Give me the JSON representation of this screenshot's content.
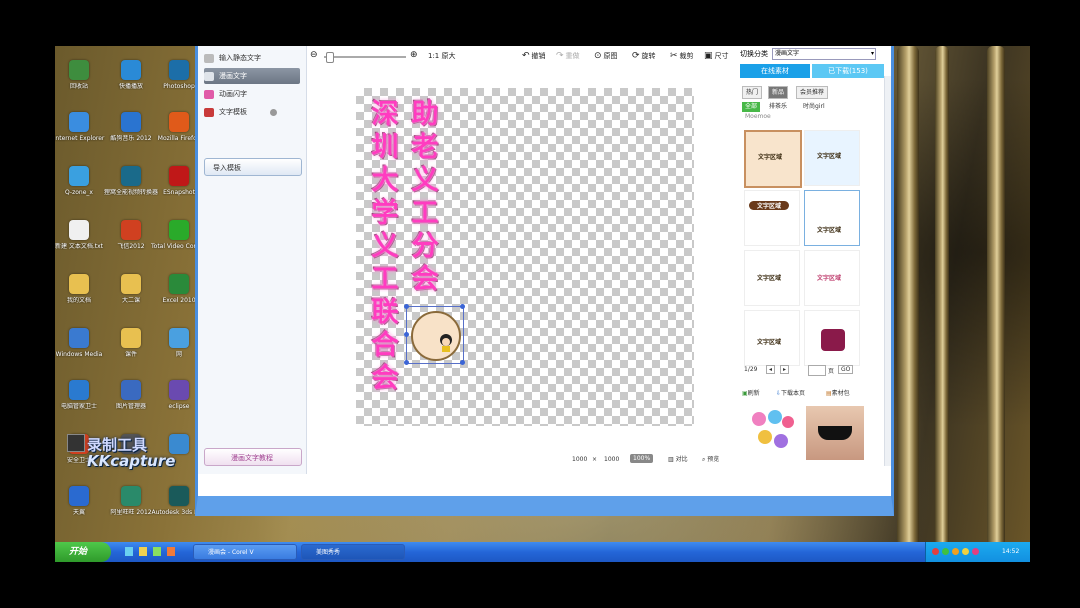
{
  "colors": {
    "accent": "#ff3cc0",
    "taskbar": "#2466d8",
    "start": "#3f9a2b",
    "tab_active": "#1aa0e8"
  },
  "desktop": {
    "icons": [
      {
        "label": "回收站",
        "icon": "recycle-bin-icon",
        "color": "#3e8d3e"
      },
      {
        "label": "快播播放",
        "icon": "kuaibo-icon",
        "color": "#2a8ad6"
      },
      {
        "label": "Photoshop",
        "icon": "photoshop-icon",
        "color": "#1c6ea8"
      },
      {
        "label": "Internet Explorer",
        "icon": "ie-icon",
        "color": "#3a8de0"
      },
      {
        "label": "酷狗音乐 2012",
        "icon": "kugou-icon",
        "color": "#2a74d0"
      },
      {
        "label": "Mozilla Firefox",
        "icon": "firefox-icon",
        "color": "#e05a1a"
      },
      {
        "label": "Q-zone_x",
        "icon": "globe-icon",
        "color": "#3aa0e0"
      },
      {
        "label": "狸窝全能视频转换器",
        "icon": "video-converter-icon",
        "color": "#1a6a8a"
      },
      {
        "label": "ESnapshot",
        "icon": "snapshot-icon",
        "color": "#c01818"
      },
      {
        "label": "新建 文本文档.txt",
        "icon": "text-file-icon",
        "color": "#f0f0f0"
      },
      {
        "label": "飞信2012",
        "icon": "fetion-icon",
        "color": "#d04020"
      },
      {
        "label": "Total Video Converter",
        "icon": "tvc-icon",
        "color": "#2aaa2a"
      },
      {
        "label": "我的文档",
        "icon": "folder-icon",
        "color": "#e8c050"
      },
      {
        "label": "大二课",
        "icon": "folder-icon",
        "color": "#e8c050"
      },
      {
        "label": "Excel 2010",
        "icon": "excel-icon",
        "color": "#2a8a3a"
      },
      {
        "label": "Windows Media",
        "icon": "media-icon",
        "color": "#3a7ad0"
      },
      {
        "label": "课件",
        "icon": "folder-icon",
        "color": "#e8c050"
      },
      {
        "label": "网",
        "icon": "network-icon",
        "color": "#4aa0e0"
      },
      {
        "label": "电脑管家卫士",
        "icon": "shield-icon",
        "color": "#2a7ad0"
      },
      {
        "label": "图片管理器",
        "icon": "image-viewer-icon",
        "color": "#3a6ac0"
      },
      {
        "label": "eclipse",
        "icon": "eclipse-icon",
        "color": "#6a4ab0"
      },
      {
        "label": "安全卫士",
        "icon": "security-icon",
        "color": "#d04020"
      },
      {
        "label": "",
        "icon": "blank-icon",
        "color": "#555"
      },
      {
        "label": "",
        "icon": "blank-icon",
        "color": "#3a8ad0"
      },
      {
        "label": "天翼",
        "icon": "star-icon",
        "color": "#2a6ad0"
      },
      {
        "label": "阿里旺旺 2012",
        "icon": "wangwang-icon",
        "color": "#2a8a6a"
      },
      {
        "label": "Autodesk 3ds Max",
        "icon": "3dsmax-icon",
        "color": "#1a5a5a"
      },
      {
        "label": "Corel VideoStudio",
        "icon": "corel-icon",
        "color": "#2a4a8a"
      }
    ],
    "watermark": {
      "line1": "录制工具",
      "line2": "KKcapture"
    }
  },
  "app": {
    "left_panel": {
      "items": [
        {
          "label": "输入静态文字",
          "icon": "text-icon"
        },
        {
          "label": "漫画文字",
          "icon": "comic-text-icon"
        },
        {
          "label": "动画闪字",
          "icon": "flash-text-icon"
        },
        {
          "label": "文字模板",
          "icon": "template-icon"
        }
      ],
      "import_label": "导入模板",
      "tutorial_label": "漫画文字教程"
    },
    "toolbar": {
      "zoom_label": "1:1 原大",
      "undo": "撤销",
      "redo": "重做",
      "original": "原图",
      "rotate": "旋转",
      "crop": "裁剪",
      "size": "尺寸"
    },
    "canvas": {
      "column_left": [
        "深",
        "圳",
        "大",
        "学",
        "义",
        "工",
        "联",
        "合",
        "会"
      ],
      "column_right": [
        "助",
        "老",
        "义",
        "工",
        "分",
        "会"
      ],
      "sticker_label": "文字区域"
    },
    "status": {
      "width": "1000",
      "times": "×",
      "height": "1000",
      "zoom_btn": "100%",
      "compare": "对比",
      "preview": "预览"
    },
    "right_panel": {
      "switch_label": "切换分类",
      "category_value": "漫画文字",
      "tab_online": "在线素材",
      "tab_downloaded": "已下载(153)",
      "cats": [
        "热门",
        "新品",
        "会员推荐"
      ],
      "subs": [
        "全部",
        "排茶乐",
        "时尚girl",
        "Moemoe"
      ],
      "thumb_label": "文字区域",
      "page_current": "1/29",
      "page_unit": "页",
      "go_label": "GO",
      "actions": [
        "刷新",
        "下载本页",
        "素材包"
      ]
    }
  },
  "taskbar": {
    "start_label": "开始",
    "tasks": [
      "漫画会 - Corel V",
      "美图秀秀"
    ],
    "clock": "14:52"
  }
}
